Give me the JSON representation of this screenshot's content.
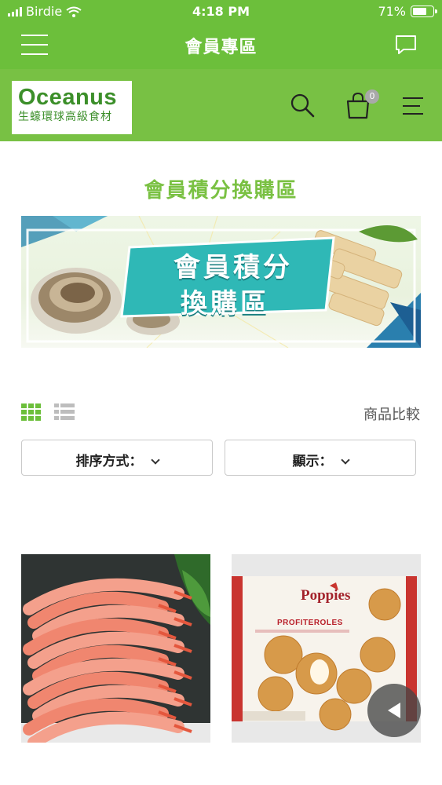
{
  "status_bar": {
    "carrier": "Birdie",
    "time": "4:18 PM",
    "battery": "71%",
    "battery_level": 0.71
  },
  "title_bar": {
    "title": "會員專區",
    "menu_icon": "hamburger-menu-icon",
    "chat_icon": "chat-bubble-icon"
  },
  "brand": {
    "logo_name": "Oceanus",
    "logo_tagline": "生蠔環球高級食材",
    "cart_count": "0",
    "icons": [
      "search-icon",
      "cart-icon",
      "menu-icon"
    ]
  },
  "section": {
    "title": "會員積分換購區",
    "banner_line1": "會員積分",
    "banner_line2": "換購區"
  },
  "toolbar": {
    "compare_label": "商品比較",
    "sort_label": "排序方式：",
    "display_label": "顯示："
  },
  "products": [
    {
      "image": "sweet-shrimp-photo"
    },
    {
      "image": "poppies-profiteroles-box",
      "brand_text": "Poppies",
      "product_text": "PROFITEROLES"
    }
  ],
  "colors": {
    "header_green": "#6cbf3b",
    "brand_green": "#78c144",
    "title_green": "#7ac143",
    "logo_green": "#3c8f2a",
    "banner_teal": "#2fb8b6"
  }
}
